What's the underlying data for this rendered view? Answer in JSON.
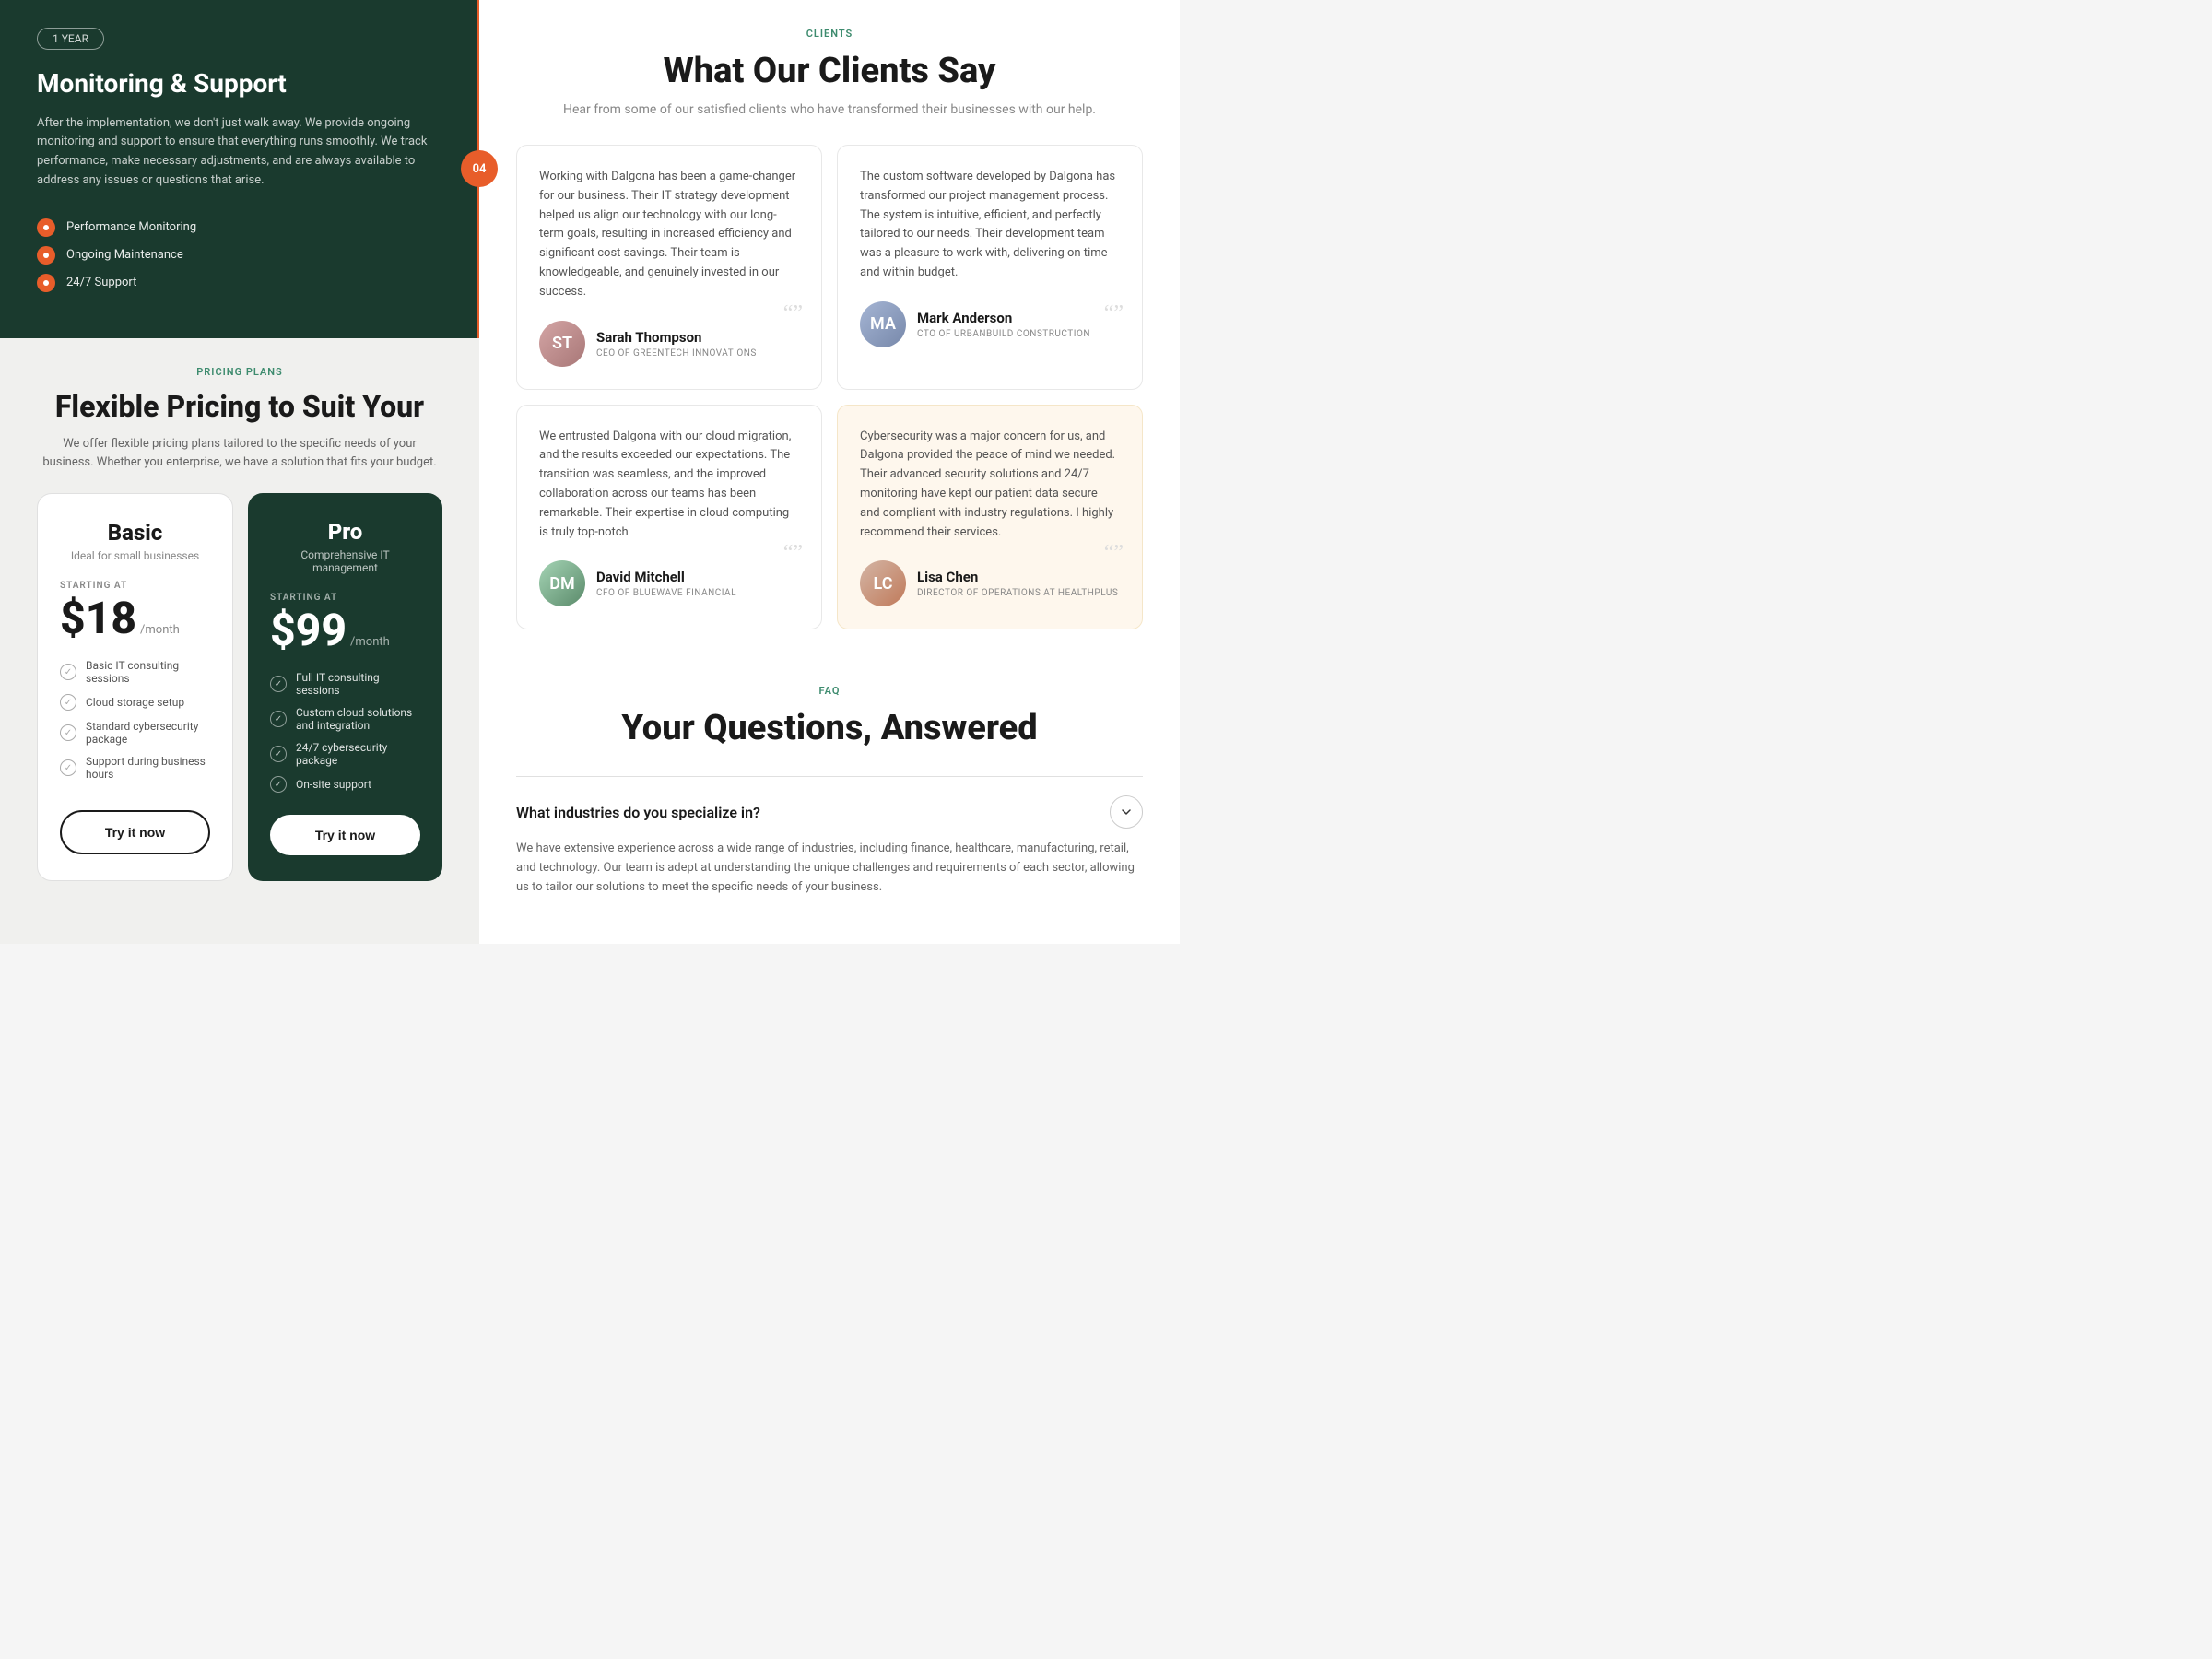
{
  "left": {
    "monitoring": {
      "badge": "1 YEAR",
      "title": "Monitoring & Support",
      "description": "After the implementation, we don't just walk away. We provide ongoing monitoring and support to ensure that everything runs smoothly. We track performance, make necessary adjustments, and are always available to address any issues or questions that arise.",
      "step": "04",
      "features": [
        "Performance Monitoring",
        "Ongoing Maintenance",
        "24/7 Support"
      ]
    },
    "pricing": {
      "label": "PRICING PLANS",
      "title": "Flexible Pricing to Suit Your",
      "subtitle": "We offer flexible pricing plans tailored to the specific needs of your business. Whether you enterprise, we have a solution that fits your budget.",
      "plans": [
        {
          "id": "basic",
          "name": "Basic",
          "desc": "Ideal for small businesses",
          "startingAt": "STARTING AT",
          "price": "$18",
          "period": "/month",
          "features": [
            "Basic IT consulting sessions",
            "Cloud storage setup",
            "Standard cybersecurity package",
            "Support during business hours"
          ],
          "cta": "Try it now"
        },
        {
          "id": "pro",
          "name": "Pro",
          "desc": "Comprehensive IT management",
          "startingAt": "STARTING AT",
          "price": "$99",
          "period": "/month",
          "features": [
            "Full IT consulting sessions",
            "Custom cloud solutions and integration",
            "24/7 cybersecurity package",
            "On-site support"
          ],
          "cta": "Try it now"
        }
      ]
    }
  },
  "right": {
    "clients": {
      "label": "CLIENTS",
      "title": "What Our Clients Say",
      "subtitle": "Hear from some of our satisfied clients who have transformed their businesses with our help.",
      "testimonials": [
        {
          "id": "t1",
          "text": "Working with Dalgona has been a game-changer for our business. Their IT strategy development helped us align our technology with our long-term goals, resulting in increased efficiency and significant cost savings. Their team is knowledgeable, and genuinely invested in our success.",
          "name": "Sarah Thompson",
          "role": "CEO OF GREENTECH INNOVATIONS",
          "avatar": "ST",
          "highlighted": false
        },
        {
          "id": "t2",
          "text": "The custom software developed by Dalgona has transformed our project management process. The system is intuitive, efficient, and perfectly tailored to our needs. Their development team was a pleasure to work with, delivering on time and within budget.",
          "name": "Mark Anderson",
          "role": "CTO OF URBANBUILD CONSTRUCTION",
          "avatar": "MA",
          "highlighted": false
        },
        {
          "id": "t3",
          "text": "We entrusted Dalgona with our cloud migration, and the results exceeded our expectations. The transition was seamless, and the improved collaboration across our teams has been remarkable. Their expertise in cloud computing is truly top-notch",
          "name": "David Mitchell",
          "role": "CFO OF BLUEWAVE FINANCIAL",
          "avatar": "DM",
          "highlighted": false
        },
        {
          "id": "t4",
          "text": "Cybersecurity was a major concern for us, and Dalgona provided the peace of mind we needed. Their advanced security solutions and 24/7 monitoring have kept our patient data secure and compliant with industry regulations. I highly recommend their services.",
          "name": "Lisa Chen",
          "role": "DIRECTOR OF OPERATIONS AT HEALTHPLUS",
          "avatar": "LC",
          "highlighted": true
        }
      ]
    },
    "faq": {
      "label": "FAQ",
      "title": "Your Questions, Answered",
      "items": [
        {
          "id": "faq1",
          "question": "What industries do you specialize in?",
          "answer": "We have extensive experience across a wide range of industries, including finance, healthcare, manufacturing, retail, and technology. Our team is adept at understanding the unique challenges and requirements of each sector, allowing us to tailor our solutions to meet the specific needs of your business.",
          "open": true
        }
      ]
    }
  }
}
